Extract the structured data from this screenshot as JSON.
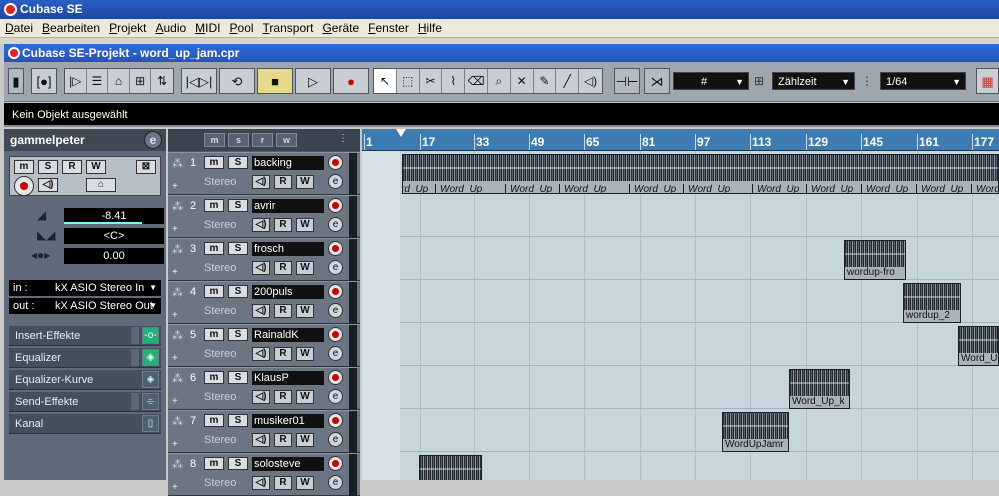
{
  "app": {
    "title": "Cubase SE",
    "menu": [
      "Datei",
      "Bearbeiten",
      "Projekt",
      "Audio",
      "MIDI",
      "Pool",
      "Transport",
      "Geräte",
      "Fenster",
      "Hilfe"
    ]
  },
  "project": {
    "title": "Cubase SE-Projekt - word_up_jam.cpr"
  },
  "toolbar": {
    "grid_mode_label": "#",
    "grid_type": "Zählzeit",
    "quantize": "1/64"
  },
  "info_line": "Kein Objekt ausgewählt",
  "inspector": {
    "track_name": "gammelpeter",
    "volume": "-8.41",
    "pan": "<C>",
    "delay": "0.00",
    "in_label": "in :",
    "in_value": "kX ASIO Stereo In",
    "out_label": "out :",
    "out_value": "kX ASIO Stereo Out",
    "sections": [
      "Insert-Effekte",
      "Equalizer",
      "Equalizer-Kurve",
      "Send-Effekte",
      "Kanal"
    ]
  },
  "tracklist_header": [
    "m",
    "s",
    "r",
    "w"
  ],
  "tracks": [
    {
      "num": "1",
      "name": "backing",
      "type": "Stereo"
    },
    {
      "num": "2",
      "name": "avrir",
      "type": "Stereo"
    },
    {
      "num": "3",
      "name": "frosch",
      "type": "Stereo"
    },
    {
      "num": "4",
      "name": "200puls",
      "type": "Stereo"
    },
    {
      "num": "5",
      "name": "RainaldK",
      "type": "Stereo"
    },
    {
      "num": "6",
      "name": "KlausP",
      "type": "Stereo"
    },
    {
      "num": "7",
      "name": "musiker01",
      "type": "Stereo"
    },
    {
      "num": "8",
      "name": "solosteve",
      "type": "Stereo"
    }
  ],
  "ruler": [
    "1",
    "17",
    "33",
    "49",
    "65",
    "81",
    "97",
    "113",
    "129",
    "145",
    "161",
    "177"
  ],
  "parts": {
    "backing_label": "Word_Up",
    "backing_labels": [
      "Word_Up",
      "Word_Up",
      "Word_Up",
      "Word_Up",
      "Word_Up",
      "Word_Up",
      "Word_Up",
      "Word_Up",
      "Word_Up",
      "Word_Up",
      "Word_U"
    ],
    "frosch": "wordup-fro",
    "puls": "wordup_2",
    "rainald": "Word_U",
    "klaus": "Word_Up_k",
    "musiker": "WordUpJamr"
  }
}
